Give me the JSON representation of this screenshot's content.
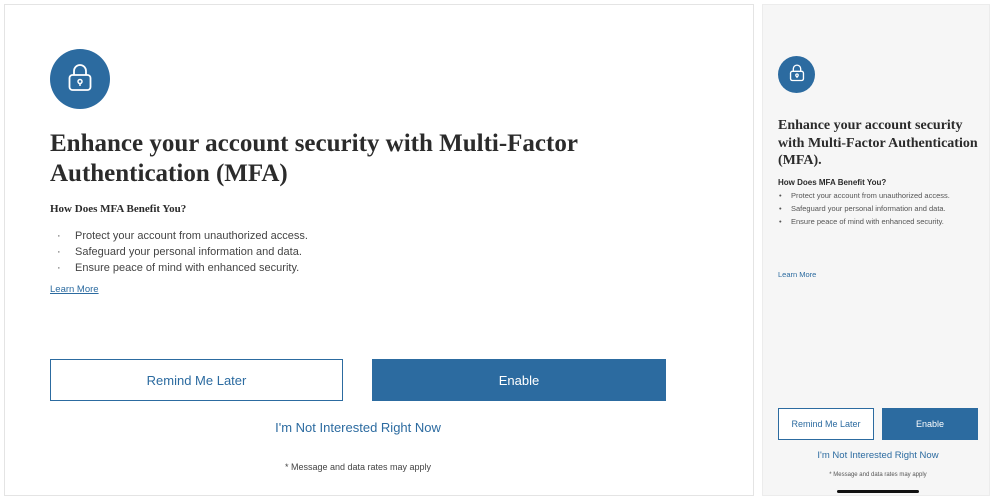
{
  "colors": {
    "accent": "#2c6ba0",
    "text": "#2b2b2b",
    "mobile_background": "#f6f6f6"
  },
  "icon": "lock-icon",
  "desktop": {
    "title": "Enhance your account security with Multi-Factor Authentication (MFA)",
    "subhead": "How Does MFA Benefit You?",
    "benefits": [
      "Protect your account from unauthorized access.",
      "Safeguard your personal information and data.",
      "Ensure peace of mind with enhanced security."
    ],
    "learn_more": "Learn More",
    "remind_label": "Remind Me Later",
    "enable_label": "Enable",
    "not_interested_label": "I'm Not Interested Right Now",
    "rates_note": "* Message and data rates may apply"
  },
  "mobile": {
    "title": "Enhance your account security with Multi-Factor Authentication (MFA).",
    "subhead": "How Does MFA Benefit You?",
    "benefits": [
      "Protect your account from unauthorized access.",
      "Safeguard your personal information and data.",
      "Ensure peace of mind with enhanced security."
    ],
    "learn_more": "Learn More",
    "remind_label": "Remind Me Later",
    "enable_label": "Enable",
    "not_interested_label": "I'm Not Interested Right Now",
    "rates_note": "* Message and data rates may apply"
  }
}
